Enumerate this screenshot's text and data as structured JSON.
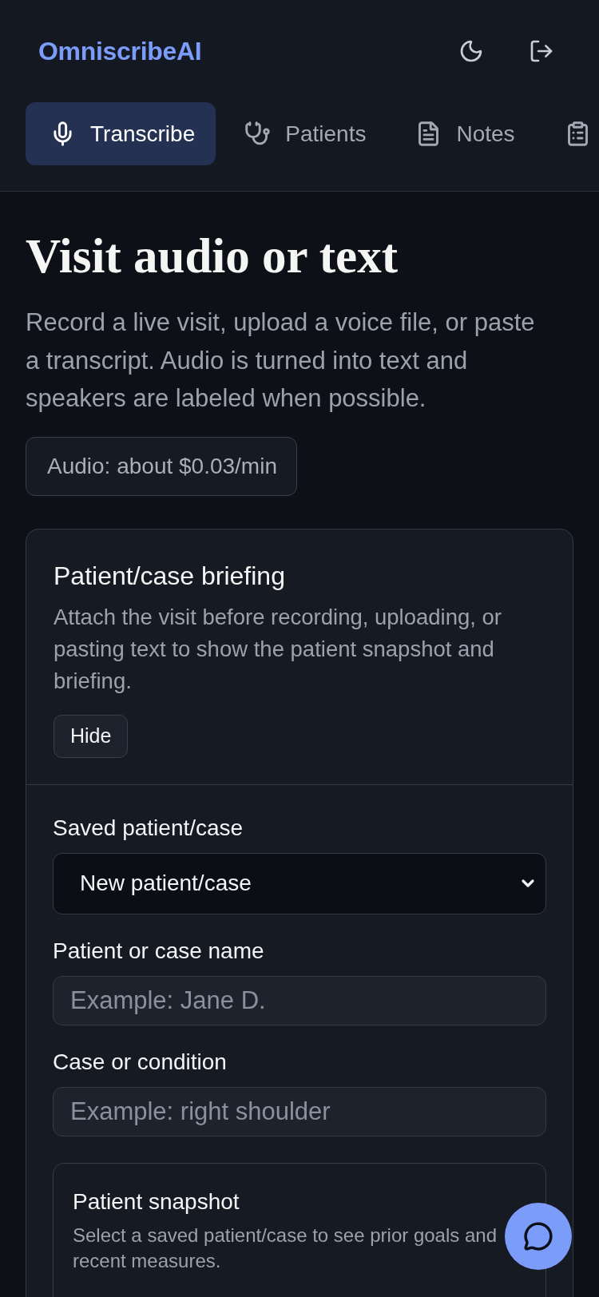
{
  "header": {
    "logo": "OmniscribeAI"
  },
  "tabs": [
    {
      "label": "Transcribe",
      "selected": true
    },
    {
      "label": "Patients",
      "selected": false
    },
    {
      "label": "Notes",
      "selected": false
    },
    {
      "selected": false
    }
  ],
  "page": {
    "title": "Visit audio or text",
    "description": "Record a live visit, upload a voice file, or paste a transcript. Audio is turned into text and speakers are labeled when possible.",
    "price_badge": "Audio: about $0.03/min"
  },
  "briefing": {
    "title": "Patient/case briefing",
    "description": "Attach the visit before recording, uploading, or pasting text to show the patient snapshot and briefing.",
    "toggle_button": "Hide",
    "fields": [
      {
        "kind": "select",
        "label": "Saved patient/case",
        "value": "New patient/case"
      },
      {
        "kind": "input",
        "label": "Patient or case name",
        "placeholder": "Example: Jane D."
      },
      {
        "kind": "input",
        "label": "Case or condition",
        "placeholder": "Example: right shoulder"
      }
    ],
    "snapshot": {
      "title": "Patient snapshot",
      "description": "Select a saved patient/case to see prior goals and recent measures."
    }
  }
}
